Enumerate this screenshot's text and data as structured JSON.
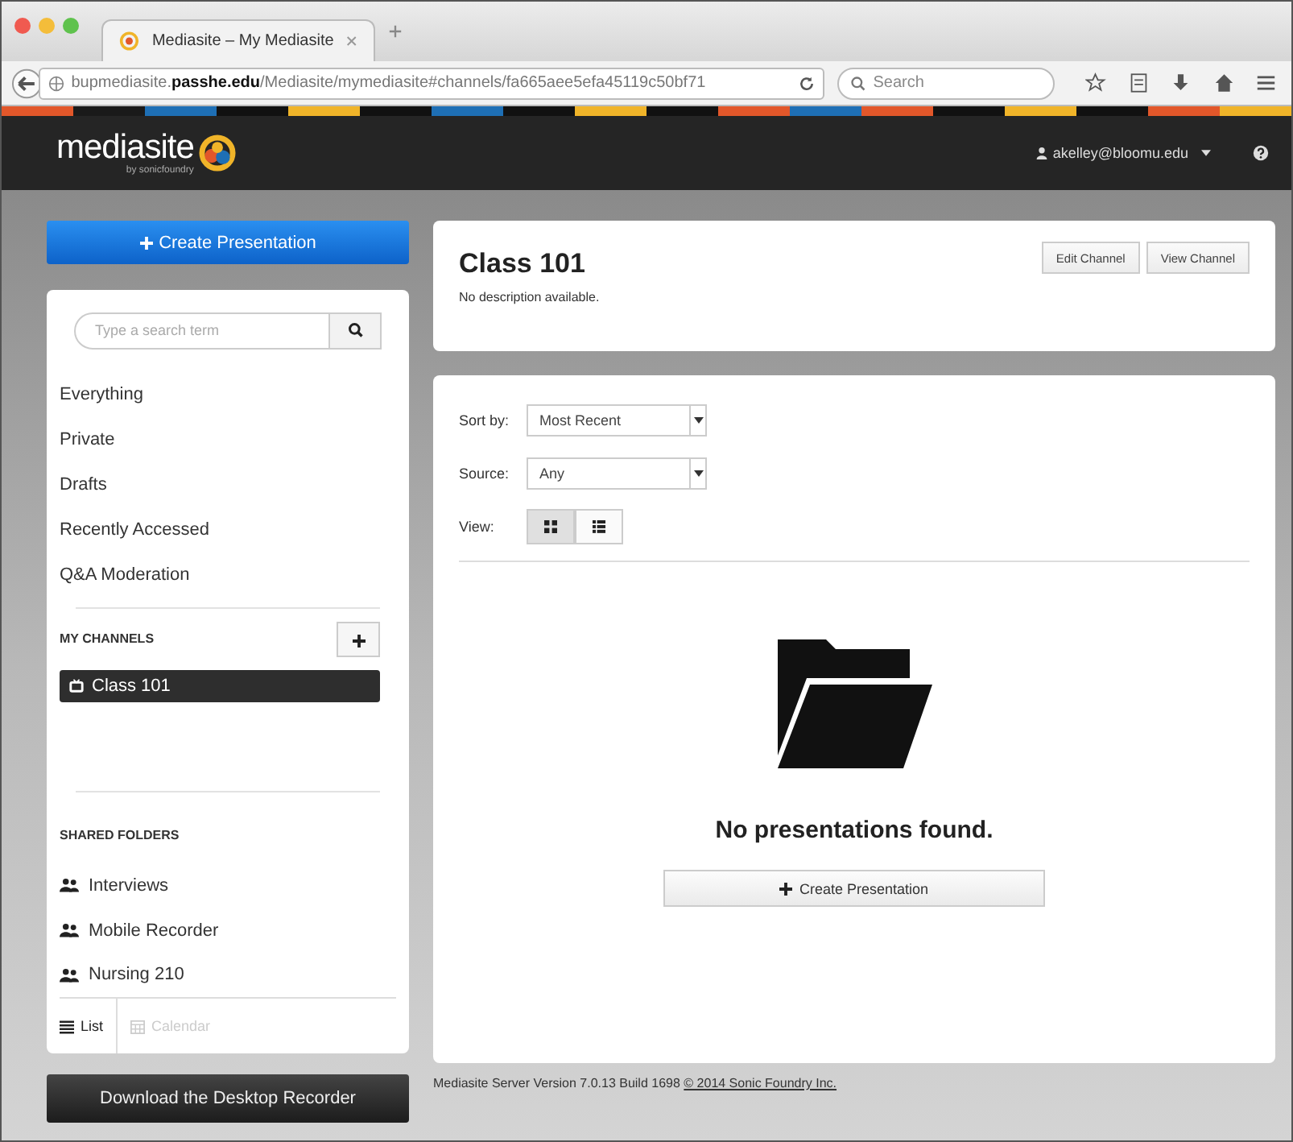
{
  "browser": {
    "tab_title": "Mediasite – My Mediasite",
    "url": "bupmediasite.**passhe.edu**/Mediasite/mymediasite#channels/fa665aee5efa45119c50bf71",
    "search_placeholder": "Search"
  },
  "header": {
    "logo": "mediasite",
    "logo_sub": "by sonicfoundry",
    "user": "akelley@bloomu.edu"
  },
  "sidebar": {
    "create_button": "Create Presentation",
    "search_placeholder": "Type a search term",
    "items": [
      {
        "label": "Everything",
        "selected": false
      },
      {
        "label": "Private",
        "selected": false
      },
      {
        "label": "Drafts",
        "selected": false
      },
      {
        "label": "Recently Accessed",
        "selected": false
      },
      {
        "label": "Q&A Moderation",
        "selected": false
      }
    ],
    "channels_heading": "MY CHANNELS",
    "channels": [
      {
        "label": "Class 101",
        "selected": true
      }
    ],
    "shared_heading": "SHARED FOLDERS",
    "shared_folders": [
      {
        "label": "Interviews"
      },
      {
        "label": "Mobile Recorder"
      },
      {
        "label": "Nursing 210"
      }
    ],
    "view_tabs": [
      {
        "label": "List",
        "kind": "list",
        "selected": true
      },
      {
        "label": "Calendar",
        "kind": "calendar",
        "selected": false
      }
    ],
    "download_button": "Download the Desktop Recorder"
  },
  "channel": {
    "title": "Class 101",
    "description": "No description available.",
    "buttons": [
      "Edit Channel",
      "View Channel"
    ]
  },
  "filters": {
    "sort_label": "Sort by:",
    "sort_value": "Most Recent",
    "source_label": "Source:",
    "source_value": "Any",
    "view_label": "View:",
    "view_options": [
      {
        "kind": "grid",
        "selected": true
      },
      {
        "kind": "list",
        "selected": false
      }
    ]
  },
  "empty": {
    "message": "No presentations found.",
    "button": "Create Presentation"
  },
  "footer": {
    "version": "Mediasite Server Version 7.0.13 Build 1698",
    "link": "© 2014 Sonic Foundry Inc."
  }
}
